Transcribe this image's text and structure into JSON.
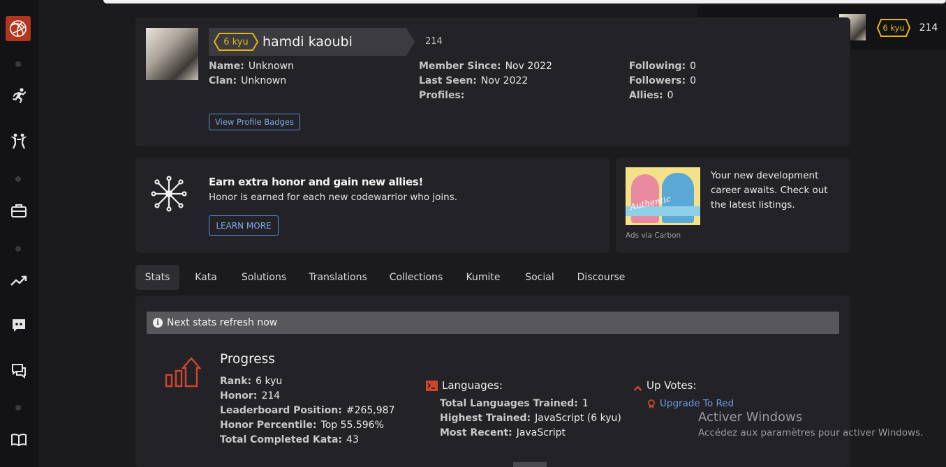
{
  "sidebar": {
    "icons": [
      "codewars-logo-icon",
      "training-icon",
      "kata-practice-icon",
      "jobs-icon",
      "leaderboard-icon",
      "discord-icon",
      "discussion-icon",
      "docs-icon"
    ]
  },
  "topbar": {
    "kyu": "6 kyu",
    "honor": "214"
  },
  "profile": {
    "kyu": "6 kyu",
    "username": "hamdi kaoubi",
    "honor": "214",
    "name_label": "Name:",
    "name_value": "Unknown",
    "clan_label": "Clan:",
    "clan_value": "Unknown",
    "member_since_label": "Member Since:",
    "member_since_value": "Nov 2022",
    "last_seen_label": "Last Seen:",
    "last_seen_value": "Nov 2022",
    "profiles_label": "Profiles:",
    "following_label": "Following:",
    "following_value": "0",
    "followers_label": "Followers:",
    "followers_value": "0",
    "allies_label": "Allies:",
    "allies_value": "0",
    "badges_button": "View Profile Badges"
  },
  "promo": {
    "title": "Earn extra honor and gain new allies!",
    "subtitle": "Honor is earned for each new codewarrior who joins.",
    "button": "LEARN MORE"
  },
  "ad": {
    "image_text": "Authentic",
    "text": "Your new development career awaits. Check out the latest listings.",
    "via": "Ads via Carbon"
  },
  "tabs": [
    "Stats",
    "Kata",
    "Solutions",
    "Translations",
    "Collections",
    "Kumite",
    "Social",
    "Discourse"
  ],
  "stats": {
    "notice": "Next stats refresh now",
    "progress_title": "Progress",
    "rank_label": "Rank:",
    "rank_value": "6 kyu",
    "honor_label": "Honor:",
    "honor_value": "214",
    "leaderboard_label": "Leaderboard Position:",
    "leaderboard_value": "#265,987",
    "percentile_label": "Honor Percentile:",
    "percentile_value": "Top 55.596%",
    "completed_label": "Total Completed Kata:",
    "completed_value": "43",
    "languages_title": "Languages:",
    "total_lang_label": "Total Languages Trained:",
    "total_lang_value": "1",
    "highest_label": "Highest Trained:",
    "highest_value": "JavaScript (6 kyu)",
    "recent_label": "Most Recent:",
    "recent_value": "JavaScript",
    "upvotes_title": "Up Votes:",
    "upgrade_link": "Upgrade To Red"
  },
  "watermark": {
    "title": "Activer Windows",
    "subtitle": "Accédez aux paramètres pour activer Windows."
  },
  "colors": {
    "accent_red": "#b1361e",
    "kyu_yellow": "#e8b515",
    "link_blue": "#5b8dd8"
  }
}
